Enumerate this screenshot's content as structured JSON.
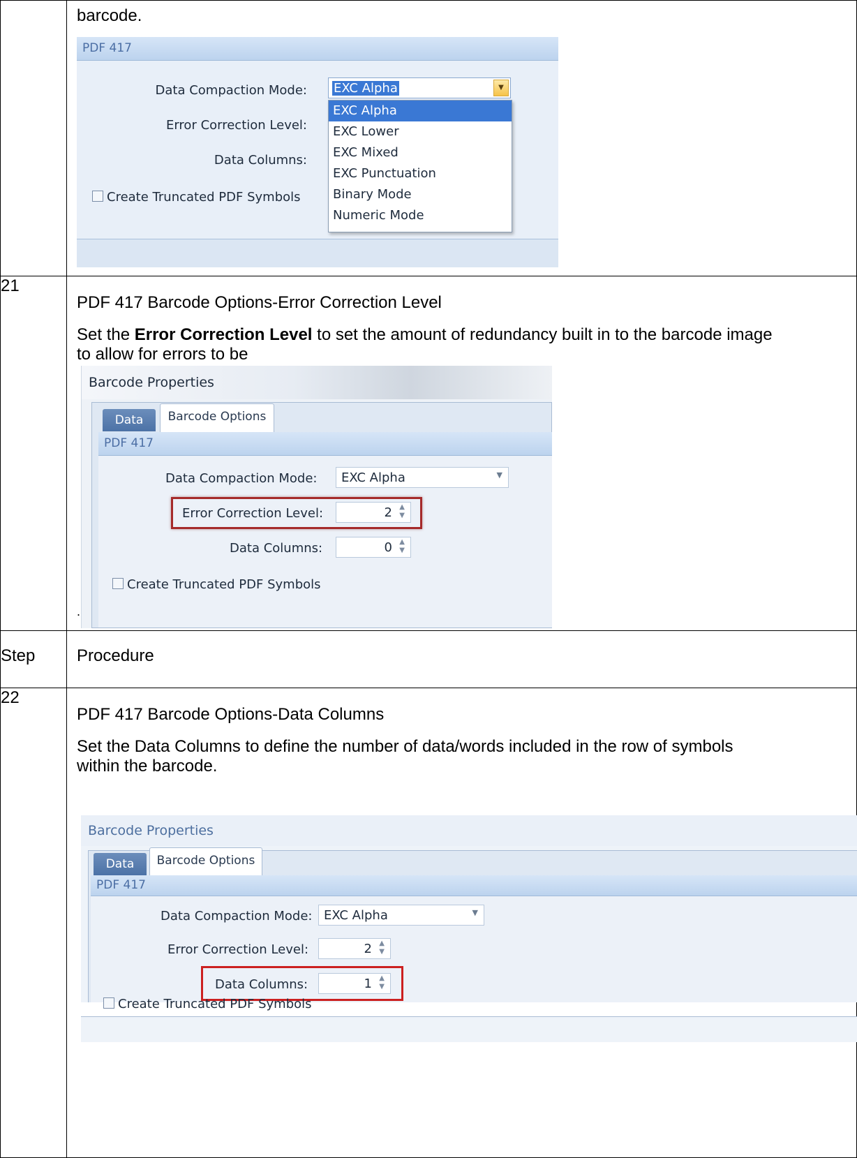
{
  "rows": {
    "top": {
      "text": "barcode.",
      "ui": {
        "group_header": "PDF 417",
        "data_compaction_label": "Data Compaction Mode:",
        "data_compaction_value": "EXC Alpha",
        "error_correction_label": "Error Correction Level:",
        "data_columns_label": "Data Columns:",
        "truncated_label": "Create Truncated PDF Symbols",
        "dropdown_options": [
          "EXC Alpha",
          "EXC Lower",
          "EXC Mixed",
          "EXC Punctuation",
          "Binary Mode",
          "Numeric Mode"
        ]
      }
    },
    "step21": {
      "step": "21",
      "title": "PDF 417 Barcode Options-Error Correction Level",
      "desc_pre": "Set the ",
      "desc_bold": "Error Correction Level",
      "desc_post": " to set the amount of redundancy built in to the barcode image to allow for errors to be",
      "dot": ".",
      "ui": {
        "window_title": "Barcode Properties",
        "tab_data": "Data",
        "tab_options": "Barcode Options",
        "group_header": "PDF 417",
        "data_compaction_label": "Data Compaction Mode:",
        "data_compaction_value": "EXC Alpha",
        "error_correction_label": "Error Correction Level:",
        "error_correction_value": "2",
        "data_columns_label": "Data Columns:",
        "data_columns_value": "0",
        "truncated_label": "Create Truncated PDF Symbols"
      }
    },
    "header": {
      "step": "Step",
      "procedure": "Procedure"
    },
    "step22": {
      "step": "22",
      "title": "PDF 417 Barcode Options-Data Columns",
      "desc": "Set the Data Columns to define the number of data/words included in the row of symbols within the barcode.",
      "ui": {
        "window_title": "Barcode Properties",
        "tab_data": "Data",
        "tab_options": "Barcode Options",
        "group_header": "PDF 417",
        "data_compaction_label": "Data Compaction Mode:",
        "data_compaction_value": "EXC Alpha",
        "error_correction_label": "Error Correction Level:",
        "error_correction_value": "2",
        "data_columns_label": "Data Columns:",
        "data_columns_value": "1",
        "truncated_label": "Create Truncated PDF Symbols"
      }
    }
  },
  "colors": {
    "highlight_red": "#cc2020",
    "dark_red": "#a52a2a",
    "selected_option": "#3a78d4",
    "group_header_text": "#4b6ea4"
  }
}
